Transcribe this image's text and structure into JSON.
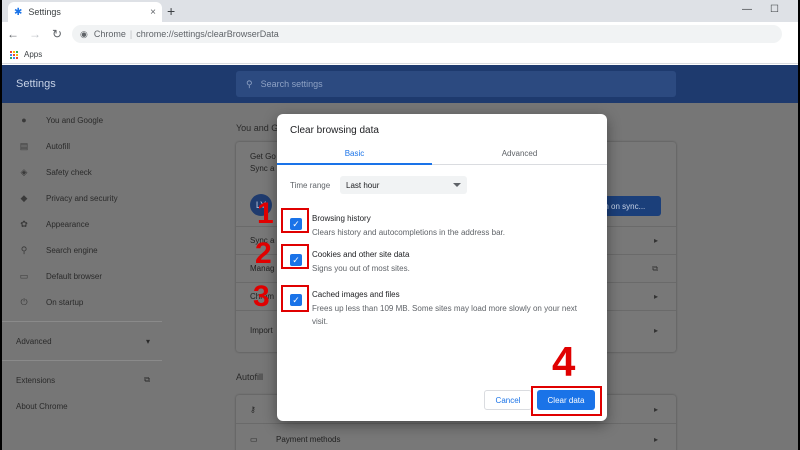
{
  "browser": {
    "tab_title": "Settings",
    "tab_close": "×",
    "new_tab": "+",
    "win_min": "—",
    "win_max": "☐",
    "url_host": "Chrome",
    "url_sep": "|",
    "url_path": "chrome://settings/clearBrowserData",
    "bookmark_apps": "Apps"
  },
  "settings": {
    "title": "Settings",
    "search_placeholder": "Search settings",
    "sidebar": [
      {
        "icon": "person-icon",
        "label": "You and Google"
      },
      {
        "icon": "clipboard-icon",
        "label": "Autofill"
      },
      {
        "icon": "shield-icon",
        "label": "Safety check"
      },
      {
        "icon": "shield-icon",
        "label": "Privacy and security"
      },
      {
        "icon": "palette-icon",
        "label": "Appearance"
      },
      {
        "icon": "search-icon",
        "label": "Search engine"
      },
      {
        "icon": "browser-icon",
        "label": "Default browser"
      },
      {
        "icon": "power-icon",
        "label": "On startup"
      }
    ],
    "advanced": "Advanced",
    "extensions": "Extensions",
    "about": "About Chrome",
    "section_you": "You and G",
    "card_get": "Get Go",
    "card_sync": "Sync a",
    "avatar": "LY",
    "turn_on_sync": "rn on sync...",
    "rows": [
      "Sync a",
      "Manag",
      "Chrom",
      "Import"
    ],
    "section_autofill": "Autofill",
    "payment_methods": "Payment methods"
  },
  "dialog": {
    "title": "Clear browsing data",
    "tab_basic": "Basic",
    "tab_advanced": "Advanced",
    "time_range_label": "Time range",
    "time_range_value": "Last hour",
    "options": [
      {
        "title": "Browsing history",
        "desc": "Clears history and autocompletions in the address bar.",
        "checked": true
      },
      {
        "title": "Cookies and other site data",
        "desc": "Signs you out of most sites.",
        "checked": true
      },
      {
        "title": "Cached images and files",
        "desc": "Frees up less than 109 MB. Some sites may load more slowly on your next visit.",
        "checked": true
      }
    ],
    "cancel": "Cancel",
    "clear": "Clear data"
  },
  "annotations": {
    "step1": "1",
    "step2": "2",
    "step3": "3",
    "step4": "4",
    "color": "#e00000"
  }
}
